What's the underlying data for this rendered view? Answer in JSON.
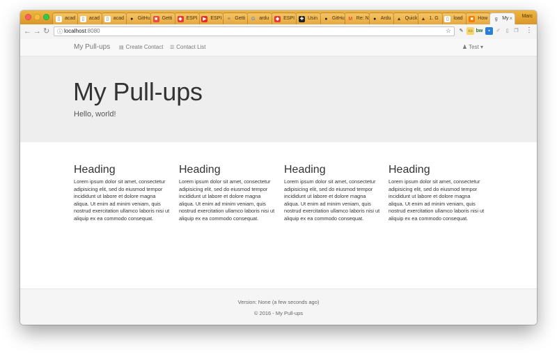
{
  "browser": {
    "tabs": [
      {
        "title": "acad",
        "icon": "document-icon"
      },
      {
        "title": "acad",
        "icon": "document-icon"
      },
      {
        "title": "acad",
        "icon": "document-icon"
      },
      {
        "title": "GitHu",
        "icon": "github-icon"
      },
      {
        "title": "Getti",
        "icon": "red-square-icon"
      },
      {
        "title": "ESPI",
        "icon": "pdf-icon"
      },
      {
        "title": "ESPI",
        "icon": "youtube-icon"
      },
      {
        "title": "Getti",
        "icon": "list-icon"
      },
      {
        "title": "ardu",
        "icon": "google-icon"
      },
      {
        "title": "ESPI",
        "icon": "pdf-icon"
      },
      {
        "title": "Usin",
        "icon": "puzzle-icon"
      },
      {
        "title": "GitHu",
        "icon": "github-icon"
      },
      {
        "title": "Re: N",
        "icon": "gmail-icon"
      },
      {
        "title": "Ardu",
        "icon": "github-icon"
      },
      {
        "title": "Quick",
        "icon": "cone-icon"
      },
      {
        "title": "1. G",
        "icon": "cone-icon"
      },
      {
        "title": "load",
        "icon": "document-icon"
      },
      {
        "title": "How",
        "icon": "orange-square-icon"
      },
      {
        "title": "My",
        "icon": "glyph-icon"
      }
    ],
    "profile_name": "Marc",
    "url_host": "localhost",
    "url_port": ":8080"
  },
  "navbar": {
    "brand": "My Pull-ups",
    "links": [
      "Create Contact",
      "Contact List"
    ],
    "user": "Test"
  },
  "jumbotron": {
    "title": "My Pull-ups",
    "subtitle": "Hello, world!"
  },
  "columns": [
    {
      "heading": "Heading",
      "text": "Lorem ipsum dolor sit amet, consectetur adipisicing elit, sed do eiusmod tempor incididunt ut labore et dolore magna aliqua. Ut enim ad minim veniam, quis nostrud exercitation ullamco laboris nisi ut aliquip ex ea commodo consequat."
    },
    {
      "heading": "Heading",
      "text": "Lorem ipsum dolor sit amet, consectetur adipisicing elit, sed do eiusmod tempor incididunt ut labore et dolore magna aliqua. Ut enim ad minim veniam, quis nostrud exercitation ullamco laboris nisi ut aliquip ex ea commodo consequat."
    },
    {
      "heading": "Heading",
      "text": "Lorem ipsum dolor sit amet, consectetur adipisicing elit, sed do eiusmod tempor incididunt ut labore et dolore magna aliqua. Ut enim ad minim veniam, quis nostrud exercitation ullamco laboris nisi ut aliquip ex ea commodo consequat."
    },
    {
      "heading": "Heading",
      "text": "Lorem ipsum dolor sit amet, consectetur adipisicing elit, sed do eiusmod tempor incididunt ut labore et dolore magna aliqua. Ut enim ad minim veniam, quis nostrud exercitation ullamco laboris nisi ut aliquip ex ea commodo consequat."
    }
  ],
  "footer": {
    "version": "Version: None (a few seconds ago)",
    "copyright": "© 2016 - My Pull-ups"
  },
  "colors": {
    "tabstrip": "#e0a535",
    "jumbotron_bg": "#eeeeee",
    "navbar_bg": "#f8f8f8",
    "footer_bg": "#f5f5f5"
  }
}
